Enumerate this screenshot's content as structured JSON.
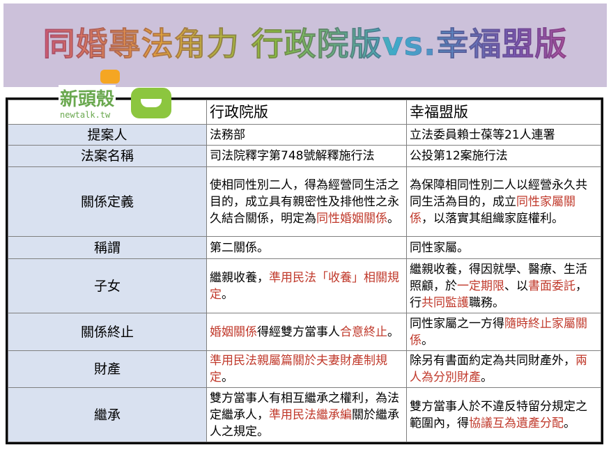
{
  "banner": {
    "title": "同婚專法角力 行政院版vs.幸福盟版"
  },
  "logo": {
    "name": "新頭殼",
    "url_text": "newtalk.tw"
  },
  "colors": {
    "banner_bg": "#ccc1da",
    "label_bg": "#d9e1f0",
    "highlight": "#c0392b"
  },
  "table": {
    "headers": [
      "",
      "行政院版",
      "幸福盟版"
    ],
    "rows": [
      {
        "label": "提案人",
        "a": [
          {
            "t": "法務部"
          }
        ],
        "b": [
          {
            "t": "立法委員賴士葆等21人連署"
          }
        ]
      },
      {
        "label": "法案名稱",
        "a": [
          {
            "t": "司法院釋字第748號解釋施行法"
          }
        ],
        "b": [
          {
            "t": "公投第12案施行法"
          }
        ]
      },
      {
        "label": "關係定義",
        "a": [
          {
            "t": "使相同性別二人，得為經營同生活之目的，成立具有親密性及排他性之永久結合關係，明定為"
          },
          {
            "t": "同性婚姻關係",
            "r": true
          },
          {
            "t": "。"
          }
        ],
        "b": [
          {
            "t": "為保障相同性別二人以經營永久共同生活為目的，成立"
          },
          {
            "t": "同性家屬關係",
            "r": true
          },
          {
            "t": "，以落實其組織家庭權利。"
          }
        ]
      },
      {
        "label": "稱謂",
        "a": [
          {
            "t": "第二關係。"
          }
        ],
        "b": [
          {
            "t": "同性家屬。"
          }
        ]
      },
      {
        "label": "子女",
        "a": [
          {
            "t": "繼親收養，"
          },
          {
            "t": "準用民法「收養」相關規定",
            "r": true
          },
          {
            "t": "。"
          }
        ],
        "b": [
          {
            "t": "繼親收養，得因就學、醫療、生活照顧，於"
          },
          {
            "t": "一定期限",
            "r": true
          },
          {
            "t": "、以"
          },
          {
            "t": "書面委託",
            "r": true
          },
          {
            "t": "，行"
          },
          {
            "t": "共同監護",
            "r": true
          },
          {
            "t": "職務。"
          }
        ]
      },
      {
        "label": "關係終止",
        "a": [
          {
            "t": "婚姻關係",
            "r": true
          },
          {
            "t": "得經雙方當事人"
          },
          {
            "t": "合意終止",
            "r": true
          },
          {
            "t": "。"
          }
        ],
        "b": [
          {
            "t": "同性家屬之一方得"
          },
          {
            "t": "隨時終止家屬關係",
            "r": true
          },
          {
            "t": "。"
          }
        ]
      },
      {
        "label": "財產",
        "a": [
          {
            "t": "準用民法親屬篇關於夫妻財產制規定",
            "r": true
          },
          {
            "t": "。"
          }
        ],
        "b": [
          {
            "t": "除另有書面約定為共同財產外，"
          },
          {
            "t": "兩人為分別財產",
            "r": true
          },
          {
            "t": "。"
          }
        ]
      },
      {
        "label": "繼承",
        "a": [
          {
            "t": "雙方當事人有相互繼承之權利，為法定繼承人，"
          },
          {
            "t": "準用民法繼承編",
            "r": true
          },
          {
            "t": "關於繼承人之規定。"
          }
        ],
        "b": [
          {
            "t": "雙方當事人於不違反特留分規定之範圍內，得"
          },
          {
            "t": "協議互為遺產分配",
            "r": true
          },
          {
            "t": "。"
          }
        ]
      }
    ]
  }
}
